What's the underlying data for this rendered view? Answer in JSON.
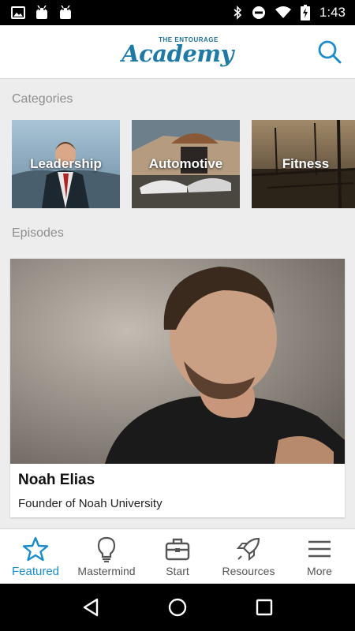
{
  "status_bar": {
    "time": "1:43",
    "left_icons": [
      "image-icon",
      "android-icon",
      "android-icon"
    ],
    "right_icons": [
      "bluetooth-icon",
      "do-not-disturb-icon",
      "wifi-icon",
      "battery-charging-icon"
    ]
  },
  "header": {
    "logo_small": "THE ENTOURAGE",
    "logo_main": "Academy",
    "search_icon": "search-icon",
    "accent_color": "#1d7aa6"
  },
  "categories": {
    "title": "Categories",
    "items": [
      {
        "label": "Leadership"
      },
      {
        "label": "Automotive"
      },
      {
        "label": "Fitness"
      }
    ]
  },
  "episodes": {
    "title": "Episodes",
    "items": [
      {
        "name": "Noah Elias",
        "description": "Founder of Noah University"
      }
    ]
  },
  "tabs": [
    {
      "label": "Featured",
      "icon": "star-icon",
      "active": true
    },
    {
      "label": "Mastermind",
      "icon": "lightbulb-icon",
      "active": false
    },
    {
      "label": "Start",
      "icon": "briefcase-icon",
      "active": false
    },
    {
      "label": "Resources",
      "icon": "rocket-icon",
      "active": false
    },
    {
      "label": "More",
      "icon": "menu-icon",
      "active": false
    }
  ],
  "active_tab_color": "#1a8ccc"
}
